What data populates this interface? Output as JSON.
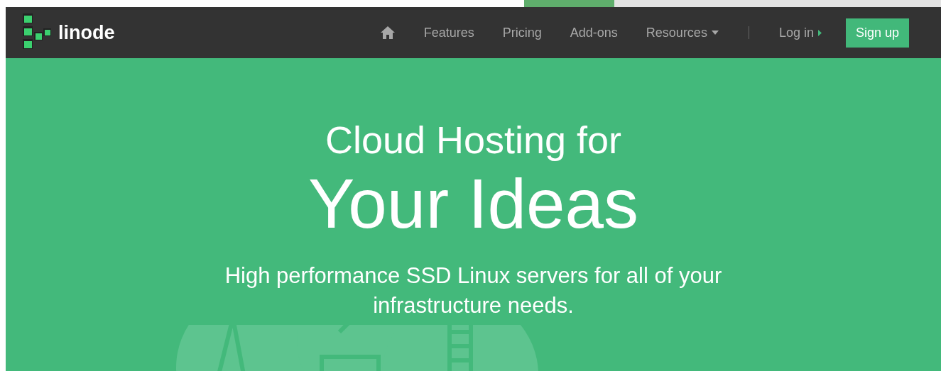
{
  "header": {
    "logo_text": "linode",
    "nav": [
      {
        "label": "Features",
        "kind": "link"
      },
      {
        "label": "Pricing",
        "kind": "link"
      },
      {
        "label": "Add-ons",
        "kind": "link"
      },
      {
        "label": "Resources",
        "kind": "dropdown"
      }
    ],
    "login": "Log in",
    "signup": "Sign up"
  },
  "hero": {
    "title": "Cloud Hosting for",
    "headline": "Your Ideas",
    "subtitle": "High performance SSD Linux servers for all of your infrastructure needs."
  }
}
